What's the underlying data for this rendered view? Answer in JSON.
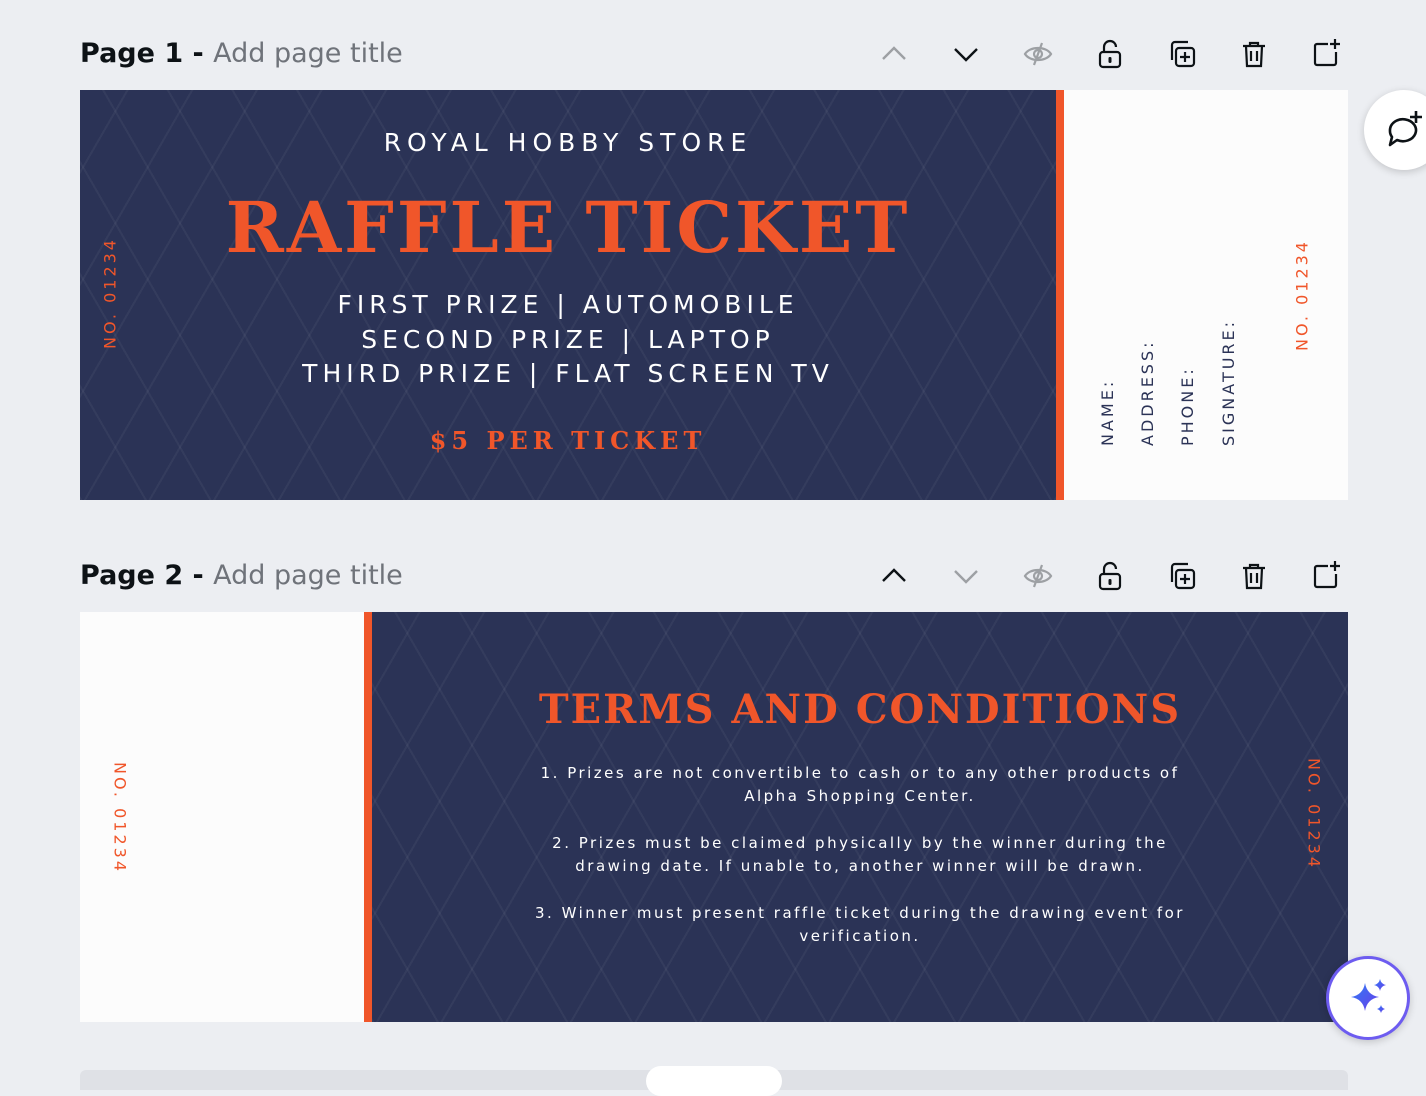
{
  "pages": [
    {
      "number_label": "Page 1 - ",
      "title_placeholder": "Add page title"
    },
    {
      "number_label": "Page 2 - ",
      "title_placeholder": "Add page title"
    }
  ],
  "ticket": {
    "store": "ROYAL HOBBY STORE",
    "title": "RAFFLE TICKET",
    "prizes": [
      "FIRST PRIZE  |  AUTOMOBILE",
      "SECOND PRIZE  |  LAPTOP",
      "THIRD PRIZE  |  FLAT SCREEN TV"
    ],
    "price": "$5 PER TICKET",
    "number": "NO. 01234",
    "stub_fields": [
      "NAME:",
      "ADDRESS:",
      "PHONE:",
      "SIGNATURE:"
    ]
  },
  "terms": {
    "title": "TERMS AND CONDITIONS",
    "items": [
      "1. Prizes are not convertible to cash or to any other products of Alpha Shopping Center.",
      "2. Prizes must be claimed physically by the winner during the drawing date. If unable to, another winner will be drawn.",
      "3. Winner must present raffle ticket during the drawing event for verification."
    ],
    "number": "NO. 01234"
  },
  "colors": {
    "navy": "#2b3356",
    "accent": "#f0562a",
    "stub": "#fcfcfc",
    "background": "#eceef2"
  },
  "icons": {
    "toolbar": [
      "chevron-up-icon",
      "chevron-down-icon",
      "eye-hidden-icon",
      "lock-icon",
      "duplicate-icon",
      "trash-icon",
      "add-page-icon"
    ],
    "side": [
      "comment-add-icon",
      "magic-sparkle-icon"
    ]
  }
}
